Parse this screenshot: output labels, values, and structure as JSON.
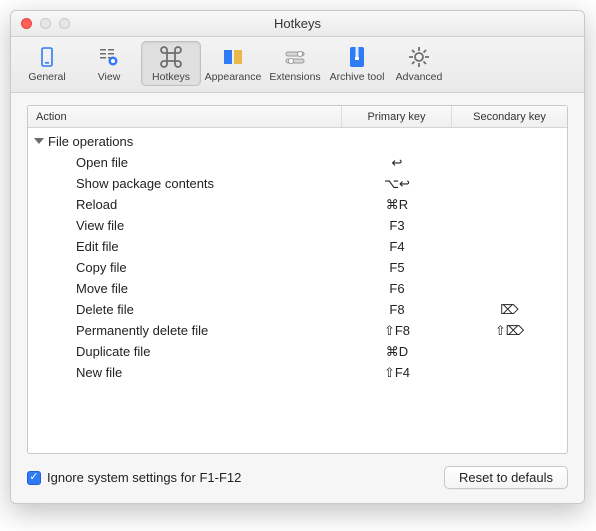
{
  "window": {
    "title": "Hotkeys"
  },
  "toolbar": {
    "items": [
      {
        "label": "General",
        "icon": "general",
        "selected": false,
        "accent": "#2f7bf6"
      },
      {
        "label": "View",
        "icon": "view",
        "selected": false,
        "accent": "#2f7bf6"
      },
      {
        "label": "Hotkeys",
        "icon": "hotkeys",
        "selected": true,
        "accent": "#6e6e6e"
      },
      {
        "label": "Appearance",
        "icon": "appearance",
        "selected": false,
        "accent": "#2f7bf6"
      },
      {
        "label": "Extensions",
        "icon": "extensions",
        "selected": false,
        "accent": "#6e6e6e"
      },
      {
        "label": "Archive tool",
        "icon": "archive",
        "selected": false,
        "accent": "#2f7bf6"
      },
      {
        "label": "Advanced",
        "icon": "advanced",
        "selected": false,
        "accent": "#6e6e6e"
      }
    ]
  },
  "columns": {
    "action": "Action",
    "primary": "Primary key",
    "secondary": "Secondary key"
  },
  "group": {
    "label": "File operations"
  },
  "rows": [
    {
      "action": "Open file",
      "primary": "↩",
      "secondary": ""
    },
    {
      "action": "Show package contents",
      "primary": "⌥↩",
      "secondary": ""
    },
    {
      "action": "Reload",
      "primary": "⌘R",
      "secondary": ""
    },
    {
      "action": "View file",
      "primary": "F3",
      "secondary": ""
    },
    {
      "action": "Edit file",
      "primary": "F4",
      "secondary": ""
    },
    {
      "action": "Copy file",
      "primary": "F5",
      "secondary": ""
    },
    {
      "action": "Move file",
      "primary": "F6",
      "secondary": ""
    },
    {
      "action": "Delete file",
      "primary": "F8",
      "secondary": "⌦"
    },
    {
      "action": "Permanently delete file",
      "primary": "⇧F8",
      "secondary": "⇧⌦"
    },
    {
      "action": "Duplicate file",
      "primary": "⌘D",
      "secondary": ""
    },
    {
      "action": "New file",
      "primary": "⇧F4",
      "secondary": ""
    }
  ],
  "footer": {
    "checkbox_label": "Ignore system settings for F1-F12",
    "checkbox_checked": true,
    "reset_label": "Reset to defauls"
  }
}
